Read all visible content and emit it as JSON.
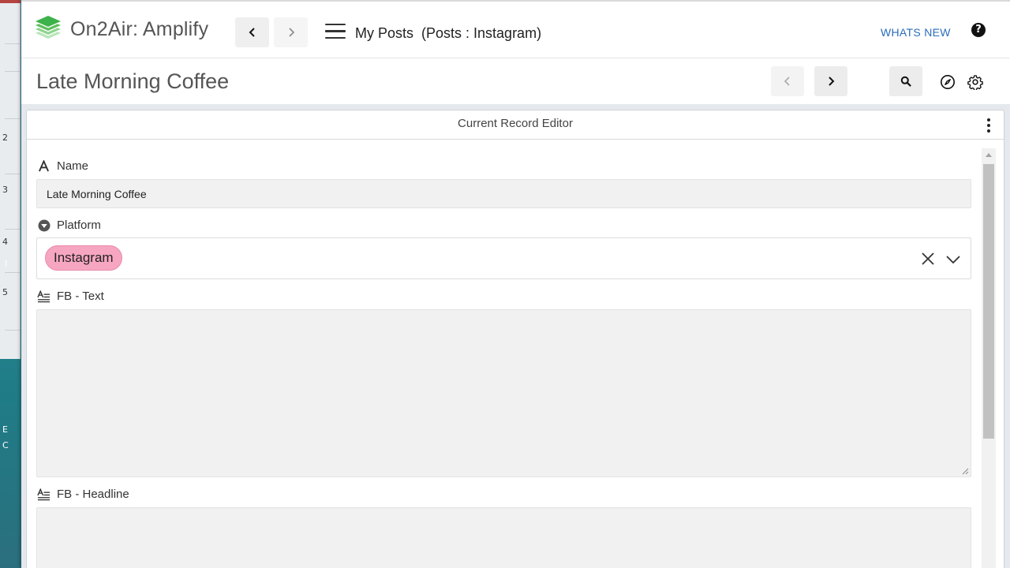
{
  "app": {
    "brand_name": "On2Air: Amplify",
    "menu_title": "My Posts",
    "menu_subtitle": "(Posts : Instagram)",
    "whats_new_label": "WHATS NEW",
    "help_symbol": "?",
    "brand_colors": {
      "logo_green": "#3db24a",
      "link_blue": "#2a6dba"
    }
  },
  "record": {
    "title": "Late Morning Coffee"
  },
  "editor": {
    "title": "Current Record Editor",
    "fields": {
      "name": {
        "label": "Name",
        "value": "Late Morning Coffee",
        "icon": "text-type-icon"
      },
      "platform": {
        "label": "Platform",
        "selected": "Instagram",
        "tag_color": "#f7a6c1",
        "icon": "dropdown-circle-icon"
      },
      "fb_text": {
        "label": "FB - Text",
        "value": "",
        "icon": "long-text-icon"
      },
      "fb_headline": {
        "label": "FB - Headline",
        "value": "",
        "icon": "long-text-icon"
      }
    }
  },
  "background": {
    "side_chars": [
      "2",
      "3",
      "4",
      "5",
      "E",
      "C",
      "I"
    ]
  }
}
